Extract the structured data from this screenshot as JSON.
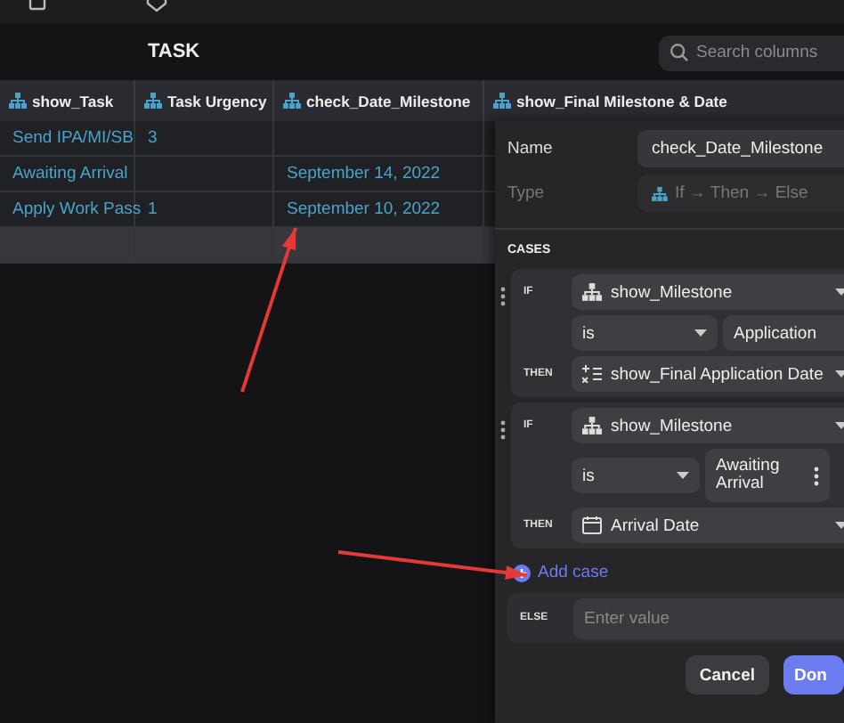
{
  "header": {
    "title": "TASK",
    "search": {
      "placeholder": "Search columns"
    }
  },
  "table": {
    "columns": [
      {
        "label": "show_Task"
      },
      {
        "label": "Task Urgency"
      },
      {
        "label": "check_Date_Milestone"
      },
      {
        "label": "show_Final Milestone & Date"
      }
    ],
    "rows": [
      {
        "task": "Send IPA/MI/SB",
        "urgency": "3"
      },
      {
        "task": "Awaiting Arrival",
        "date": "September 14, 2022"
      },
      {
        "task": "Apply Work Pass",
        "urgency": "1",
        "date": "September 10, 2022"
      }
    ]
  },
  "panel": {
    "name_label": "Name",
    "name_value": "check_Date_Milestone",
    "type_label": "Type",
    "type_value": "If → Then → Else",
    "type_disabled": true,
    "cases_label": "CASES",
    "cases": [
      {
        "if_label": "IF",
        "field": "show_Milestone",
        "operator": "is",
        "value": "Application",
        "then_label": "THEN",
        "kind": "formula",
        "then_value": "show_Final Application Date"
      },
      {
        "if_label": "IF",
        "field": "show_Milestone",
        "operator": "is",
        "value": "Awaiting Arrival",
        "menu": true,
        "then_label": "THEN",
        "kind": "date",
        "then_value": "Arrival Date"
      }
    ],
    "add_case": "Add case",
    "else_label": "ELSE",
    "else_placeholder": "Enter value",
    "buttons": [
      {
        "label": "Cancel",
        "kind": "secondary"
      },
      {
        "label": "Don",
        "kind": "primary"
      }
    ]
  },
  "annotations": [
    {
      "kind": "arrow"
    },
    {
      "kind": "arrow"
    }
  ]
}
